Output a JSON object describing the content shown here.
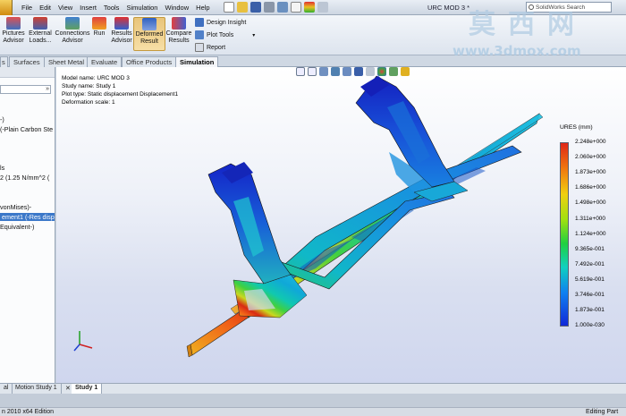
{
  "menubar": {
    "menus": [
      "File",
      "Edit",
      "View",
      "Insert",
      "Tools",
      "Simulation",
      "Window",
      "Help"
    ],
    "doc_title": "URC MOD 3 *",
    "search_placeholder": "SolidWorks Search"
  },
  "toolbar": {
    "pictures_advisor": "Pictures\nAdvisor",
    "external_loads": "External\nLoads...",
    "connections_advisor": "Connections\nAdvisor",
    "run": "Run",
    "results_advisor": "Results\nAdvisor",
    "deformed_result": "Deformed\nResult",
    "compare_results": "Compare\nResults",
    "design_insight": "Design Insight",
    "plot_tools": "Plot Tools",
    "report": "Report"
  },
  "tabs": [
    "Surfaces",
    "Sheet Metal",
    "Evaluate",
    "Office Products",
    "Simulation"
  ],
  "active_tab": "Simulation",
  "tree": {
    "items": [
      "-)",
      "(-Plain Carbon Ste",
      "ls",
      "2 (1.25 N/mm^2 (",
      "vonMises)-",
      "ement1 (-Res disp",
      "Equivalent-)"
    ],
    "selected_index": 5
  },
  "viewport": {
    "model_name": "Model name: URC MOD 3",
    "study_name": "Study name: Study 1",
    "plot_type": "Plot type: Static displacement Displacement1",
    "deformation_scale": "Deformation scale: 1"
  },
  "legend": {
    "title": "URES (mm)",
    "ticks": [
      "2.248e+000",
      "2.060e+000",
      "1.873e+000",
      "1.686e+000",
      "1.498e+000",
      "1.311e+000",
      "1.124e+000",
      "9.365e-001",
      "7.492e-001",
      "5.619e-001",
      "3.746e-001",
      "1.873e-001",
      "1.000e-030"
    ]
  },
  "bottom_tabs": [
    "al",
    "Motion Study 1",
    "Study 1"
  ],
  "active_bottom_tab": "Study 1",
  "status": {
    "left": "n 2010 x64 Edition",
    "right": "Editing Part"
  },
  "watermark": {
    "chinese": "莫西网",
    "url": "www.3dmox.com"
  },
  "colors": {
    "accent": "#3b78c9",
    "max_displacement": "#e02818",
    "min_displacement": "#1028d8"
  }
}
